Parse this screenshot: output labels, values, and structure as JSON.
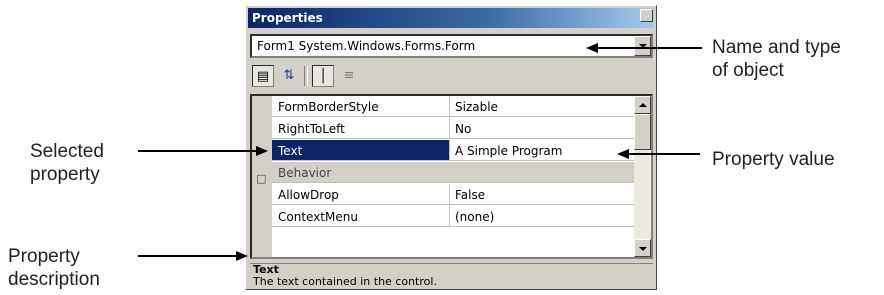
{
  "window": {
    "title": "Properties",
    "object_selector": "Form1  System.Windows.Forms.Form",
    "toolbar": [
      "categorized-icon",
      "alphabetical-icon",
      "properties-icon",
      "events-icon"
    ],
    "rows": [
      {
        "name": "FormBorderStyle",
        "value": "Sizable"
      },
      {
        "name": "RightToLeft",
        "value": "No"
      },
      {
        "name": "Text",
        "value": "A Simple Program",
        "selected": true
      },
      {
        "name": "Behavior",
        "category": true
      },
      {
        "name": "AllowDrop",
        "value": "False"
      },
      {
        "name": "ContextMenu",
        "value": "(none)"
      }
    ],
    "description": {
      "title": "Text",
      "body": "The text contained in the control."
    }
  },
  "callouts": {
    "name_type": "Name and type\nof object",
    "property_value": "Property value",
    "selected_property": "Selected\nproperty",
    "property_description": "Property\ndescription"
  }
}
